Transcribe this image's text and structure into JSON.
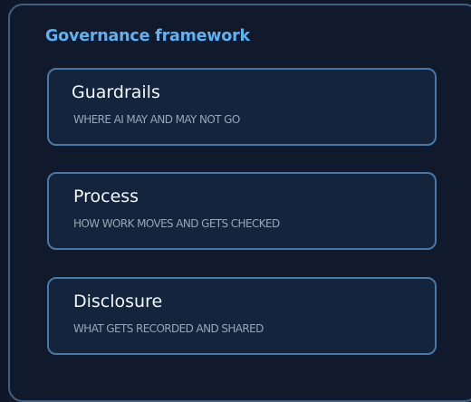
{
  "panel": {
    "title": "Governance framework"
  },
  "cards": [
    {
      "title": "Guardrails",
      "subtitle": "WHERE AI MAY AND MAY NOT GO"
    },
    {
      "title": "Process",
      "subtitle": "HOW WORK MOVES AND GETS CHECKED"
    },
    {
      "title": "Disclosure",
      "subtitle": "WHAT GETS RECORDED AND SHARED"
    }
  ],
  "colors": {
    "background": "#0f1729",
    "panel_border": "#3d5f82",
    "title_accent": "#5fb2f1",
    "card_fill": "#13243c",
    "card_border": "#4778a6",
    "card_title": "#f3f6fa",
    "card_subtitle": "#97a6b8"
  }
}
